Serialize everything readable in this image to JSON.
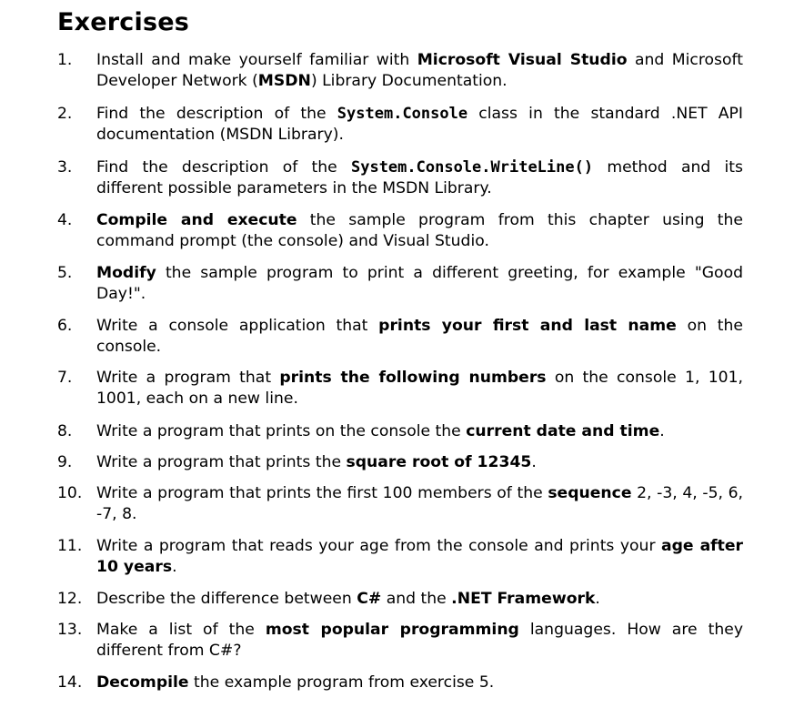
{
  "heading": "Exercises",
  "exercises": [
    {
      "number": "1.",
      "segments": [
        {
          "text": "Install and make yourself familiar with "
        },
        {
          "text": "Microsoft Visual Studio",
          "style": "bold"
        },
        {
          "text": " and Microsoft Developer Network ("
        },
        {
          "text": "MSDN",
          "style": "bold"
        },
        {
          "text": ") Library Documentation."
        }
      ]
    },
    {
      "number": "2.",
      "segments": [
        {
          "text": "Find the description of the "
        },
        {
          "text": "System.Console",
          "style": "code"
        },
        {
          "text": " class in the standard .NET API documentation (MSDN Library)."
        }
      ]
    },
    {
      "number": "3.",
      "segments": [
        {
          "text": "Find the description of the "
        },
        {
          "text": "System.Console.WriteLine()",
          "style": "code"
        },
        {
          "text": " method and its different possible parameters in the MSDN Library."
        }
      ]
    },
    {
      "number": "4.",
      "segments": [
        {
          "text": "Compile and execute",
          "style": "bold"
        },
        {
          "text": " the sample program from this chapter using the command prompt (the console) and Visual Studio."
        }
      ]
    },
    {
      "number": "5.",
      "segments": [
        {
          "text": "Modify",
          "style": "bold"
        },
        {
          "text": " the sample program to print a different greeting, for example \"Good Day!\"."
        }
      ]
    },
    {
      "number": "6.",
      "segments": [
        {
          "text": "Write a console application that "
        },
        {
          "text": "prints your first and last name",
          "style": "bold"
        },
        {
          "text": " on the console."
        }
      ]
    },
    {
      "number": "7.",
      "segments": [
        {
          "text": "Write a program that "
        },
        {
          "text": "prints the following numbers",
          "style": "bold"
        },
        {
          "text": " on the console 1, 101, 1001, each on a new line."
        }
      ]
    },
    {
      "number": "8.",
      "segments": [
        {
          "text": "Write a program that prints on the console the "
        },
        {
          "text": "current date and time",
          "style": "bold"
        },
        {
          "text": "."
        }
      ]
    },
    {
      "number": "9.",
      "segments": [
        {
          "text": "Write a program that prints the "
        },
        {
          "text": "square root of 12345",
          "style": "bold"
        },
        {
          "text": "."
        }
      ]
    },
    {
      "number": "10.",
      "segments": [
        {
          "text": "Write a program that prints the first 100 members of the "
        },
        {
          "text": "sequence",
          "style": "bold"
        },
        {
          "text": " 2, -3, 4, -5, 6, -7, 8."
        }
      ]
    },
    {
      "number": "11.",
      "segments": [
        {
          "text": "Write a program that reads your age from the console and prints your "
        },
        {
          "text": "age after 10 years",
          "style": "bold"
        },
        {
          "text": "."
        }
      ]
    },
    {
      "number": "12.",
      "segments": [
        {
          "text": "Describe the difference between "
        },
        {
          "text": "C#",
          "style": "bold"
        },
        {
          "text": " and the "
        },
        {
          "text": ".NET Framework",
          "style": "bold"
        },
        {
          "text": "."
        }
      ]
    },
    {
      "number": "13.",
      "segments": [
        {
          "text": "Make a list of the "
        },
        {
          "text": "most popular programming",
          "style": "bold"
        },
        {
          "text": " languages. How are they different from C#?"
        }
      ]
    },
    {
      "number": "14.",
      "segments": [
        {
          "text": "Decompile",
          "style": "bold"
        },
        {
          "text": " the example program from exercise 5."
        }
      ]
    }
  ]
}
